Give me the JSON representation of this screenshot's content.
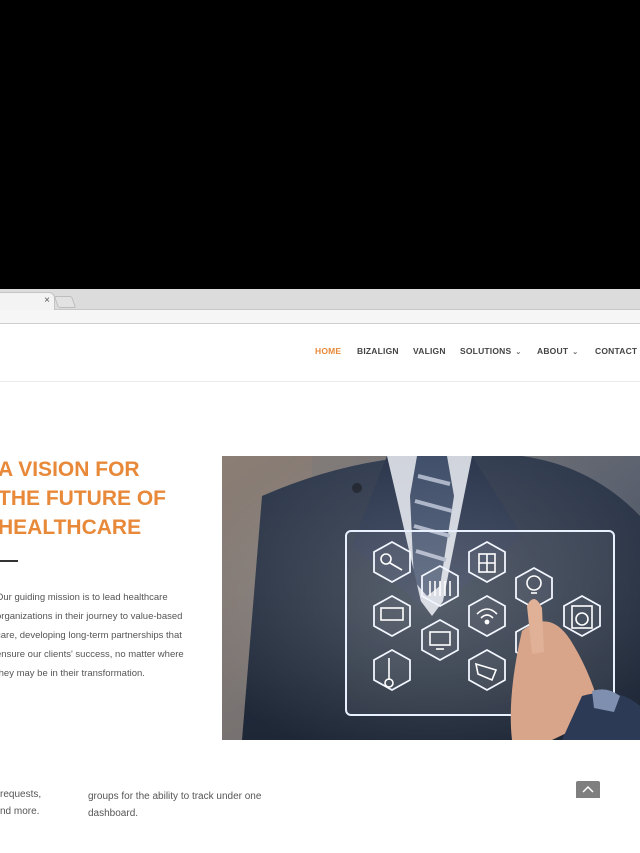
{
  "browser": {
    "tab_close": "×"
  },
  "nav": {
    "items": [
      {
        "label": "HOME",
        "active": true
      },
      {
        "label": "BIZALIGN"
      },
      {
        "label": "VALIGN"
      },
      {
        "label": "SOLUTIONS",
        "dropdown": true
      },
      {
        "label": "ABOUT",
        "dropdown": true
      },
      {
        "label": "CONTACT U"
      }
    ],
    "accent_color": "#e8893a"
  },
  "hero": {
    "title_lines": [
      "A VISION FOR",
      "THE FUTURE OF",
      "HEALTHCARE"
    ],
    "mission_lines": [
      "Our guiding mission is to lead healthcare",
      "organizations in their journey to value-based",
      "care, developing long-term partnerships that",
      "ensure our clients' success, no matter where",
      "they may be in their transformation."
    ],
    "image_icons": [
      "key-icon",
      "blinds-icon",
      "radiator-icon",
      "lightbulb-icon",
      "air-conditioner-icon",
      "wifi-icon",
      "washing-machine-icon",
      "computer-icon",
      "refrigerator-icon",
      "thermometer-icon",
      "security-camera-icon"
    ]
  },
  "bottom": {
    "left_lines": [
      "requests,",
      "nd more."
    ],
    "mid_lines": [
      "groups for the ability to track under one",
      "dashboard."
    ]
  },
  "icons": {
    "scroll_top": "chevron-up-icon",
    "dropdown": "chevron-down-icon"
  }
}
